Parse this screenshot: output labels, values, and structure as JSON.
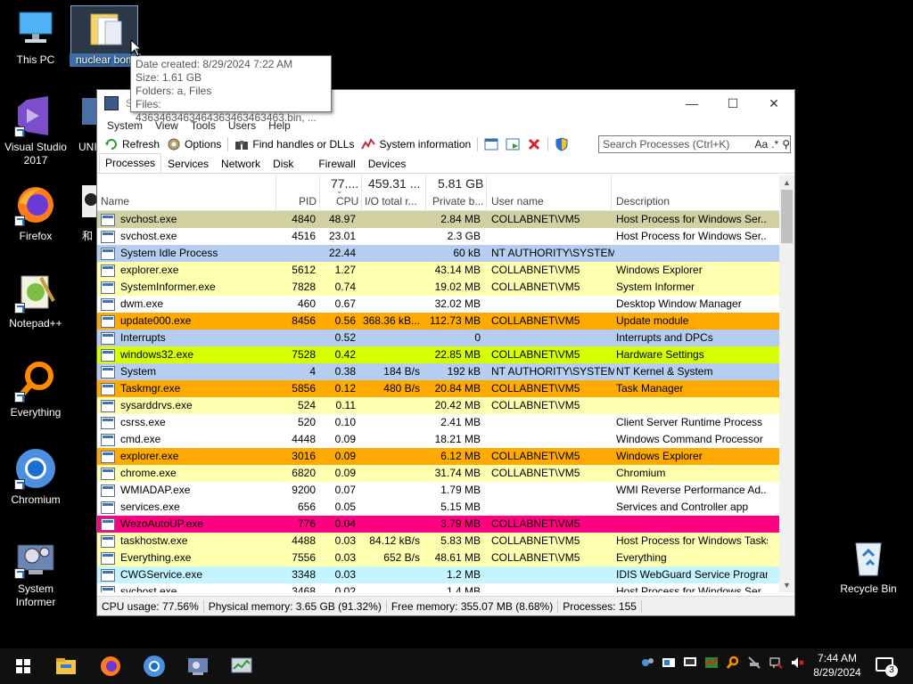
{
  "desktop": {
    "icons": [
      {
        "label": "This PC"
      },
      {
        "label": "nuclear bom"
      },
      {
        "label": "Visual Studio 2017"
      },
      {
        "label": "UNI"
      },
      {
        "label": "Firefox"
      },
      {
        "label": "和"
      },
      {
        "label": "Notepad++"
      },
      {
        "label": "Everything"
      },
      {
        "label": "Chromium"
      },
      {
        "label": "System Informer"
      },
      {
        "label": "Recycle Bin"
      }
    ]
  },
  "tooltip": {
    "lines": [
      "Date created: 8/29/2024 7:22 AM",
      "Size: 1.61 GB",
      "Folders: a, Files",
      "Files: 4363463463464363463463463.bin, ..."
    ]
  },
  "window": {
    "title": "Sy",
    "menu": [
      "System",
      "View",
      "Tools",
      "Users",
      "Help"
    ],
    "toolbar": {
      "refresh": "Refresh",
      "options": "Options",
      "find_handles": "Find handles or DLLs",
      "system_information": "System information"
    },
    "search": {
      "placeholder": "Search Processes (Ctrl+K)",
      "case": "Aa",
      "regex": ".*"
    },
    "tabs": [
      "Processes",
      "Services",
      "Network",
      "Disk",
      "Firewall",
      "Devices"
    ],
    "columns": {
      "name": "Name",
      "pid": "PID",
      "cpu": "CPU",
      "io": "I/O total r...",
      "private": "Private b...",
      "user": "User name",
      "description": "Description"
    },
    "summary": {
      "cpu": "77....",
      "io": "459.31 ...",
      "private": "5.81 GB"
    },
    "processes": [
      {
        "name": "svchost.exe",
        "pid": "4840",
        "cpu": "48.97",
        "io": "",
        "private": "2.84 MB",
        "user": "COLLABNET\\VM5",
        "desc": "Host Process for Windows Ser...",
        "color": "#d0d0a0"
      },
      {
        "name": "svchost.exe",
        "pid": "4516",
        "cpu": "23.01",
        "io": "",
        "private": "2.3 GB",
        "user": "",
        "desc": "Host Process for Windows Ser...",
        "color": "#ffffff"
      },
      {
        "name": "System Idle Process",
        "pid": "",
        "cpu": "22.44",
        "io": "",
        "private": "60 kB",
        "user": "NT AUTHORITY\\SYSTEM",
        "desc": "",
        "color": "#b4cdf0"
      },
      {
        "name": "explorer.exe",
        "pid": "5612",
        "cpu": "1.27",
        "io": "",
        "private": "43.14 MB",
        "user": "COLLABNET\\VM5",
        "desc": "Windows Explorer",
        "color": "#ffffb0"
      },
      {
        "name": "SystemInformer.exe",
        "pid": "7828",
        "cpu": "0.74",
        "io": "",
        "private": "19.02 MB",
        "user": "COLLABNET\\VM5",
        "desc": "System Informer",
        "color": "#ffffb0"
      },
      {
        "name": "dwm.exe",
        "pid": "460",
        "cpu": "0.67",
        "io": "",
        "private": "32.02 MB",
        "user": "",
        "desc": "Desktop Window Manager",
        "color": "#ffffff"
      },
      {
        "name": "update000.exe",
        "pid": "8456",
        "cpu": "0.56",
        "io": "368.36 kB...",
        "private": "112.73 MB",
        "user": "COLLABNET\\VM5",
        "desc": "Update module",
        "color": "#ffaa00"
      },
      {
        "name": "Interrupts",
        "pid": "",
        "cpu": "0.52",
        "io": "",
        "private": "0",
        "user": "",
        "desc": "Interrupts and DPCs",
        "color": "#b4cdf0"
      },
      {
        "name": "windows32.exe",
        "pid": "7528",
        "cpu": "0.42",
        "io": "",
        "private": "22.85 MB",
        "user": "COLLABNET\\VM5",
        "desc": "Hardware Settings",
        "color": "#d6ff00"
      },
      {
        "name": "System",
        "pid": "4",
        "cpu": "0.38",
        "io": "184 B/s",
        "private": "192 kB",
        "user": "NT AUTHORITY\\SYSTEM",
        "desc": "NT Kernel & System",
        "color": "#b4cdf0"
      },
      {
        "name": "Taskmgr.exe",
        "pid": "5856",
        "cpu": "0.12",
        "io": "480 B/s",
        "private": "20.84 MB",
        "user": "COLLABNET\\VM5",
        "desc": "Task Manager",
        "color": "#ffaa00"
      },
      {
        "name": "sysarddrvs.exe",
        "pid": "524",
        "cpu": "0.11",
        "io": "",
        "private": "20.42 MB",
        "user": "COLLABNET\\VM5",
        "desc": "",
        "color": "#ffffb0"
      },
      {
        "name": "csrss.exe",
        "pid": "520",
        "cpu": "0.10",
        "io": "",
        "private": "2.41 MB",
        "user": "",
        "desc": "Client Server Runtime Process",
        "color": "#ffffff"
      },
      {
        "name": "cmd.exe",
        "pid": "4448",
        "cpu": "0.09",
        "io": "",
        "private": "18.21 MB",
        "user": "",
        "desc": "Windows Command Processor",
        "color": "#ffffff"
      },
      {
        "name": "explorer.exe",
        "pid": "3016",
        "cpu": "0.09",
        "io": "",
        "private": "6.12 MB",
        "user": "COLLABNET\\VM5",
        "desc": "Windows Explorer",
        "color": "#ffaa00"
      },
      {
        "name": "chrome.exe",
        "pid": "6820",
        "cpu": "0.09",
        "io": "",
        "private": "31.74 MB",
        "user": "COLLABNET\\VM5",
        "desc": "Chromium",
        "color": "#ffffb0"
      },
      {
        "name": "WMIADAP.exe",
        "pid": "9200",
        "cpu": "0.07",
        "io": "",
        "private": "1.79 MB",
        "user": "",
        "desc": "WMI Reverse Performance Ad...",
        "color": "#ffffff"
      },
      {
        "name": "services.exe",
        "pid": "656",
        "cpu": "0.05",
        "io": "",
        "private": "5.15 MB",
        "user": "",
        "desc": "Services and Controller app",
        "color": "#ffffff"
      },
      {
        "name": "WezoAutoUP.exe",
        "pid": "776",
        "cpu": "0.04",
        "io": "",
        "private": "3.79 MB",
        "user": "COLLABNET\\VM5",
        "desc": "",
        "color": "#ff0080"
      },
      {
        "name": "taskhostw.exe",
        "pid": "4488",
        "cpu": "0.03",
        "io": "84.12 kB/s",
        "private": "5.83 MB",
        "user": "COLLABNET\\VM5",
        "desc": "Host Process for Windows Tasks",
        "color": "#ffffb0"
      },
      {
        "name": "Everything.exe",
        "pid": "7556",
        "cpu": "0.03",
        "io": "652 B/s",
        "private": "48.61 MB",
        "user": "COLLABNET\\VM5",
        "desc": "Everything",
        "color": "#ffffb0"
      },
      {
        "name": "CWGService.exe",
        "pid": "3348",
        "cpu": "0.03",
        "io": "",
        "private": "1.2 MB",
        "user": "",
        "desc": "IDIS WebGuard Service Program",
        "color": "#c4f4ff"
      },
      {
        "name": "svchost.exe",
        "pid": "3468",
        "cpu": "0.02",
        "io": "",
        "private": "1.4 MB",
        "user": "",
        "desc": "Host Process for Windows Ser...",
        "color": "#ffffff"
      }
    ],
    "status": {
      "cpu": "CPU usage: 77.56%",
      "phys": "Physical memory: 3.65 GB (91.32%)",
      "free": "Free memory: 355.07 MB (8.68%)",
      "procs": "Processes: 155"
    }
  },
  "taskbar": {
    "time": "7:44 AM",
    "date": "8/29/2024",
    "notifications": "3"
  }
}
